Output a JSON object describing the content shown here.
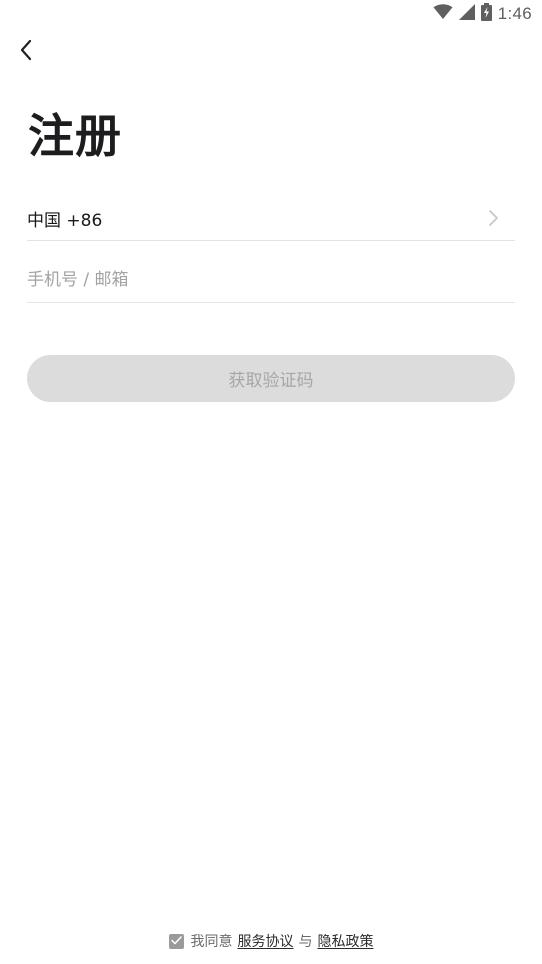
{
  "status_bar": {
    "time": "1:46",
    "icons": [
      "wifi-icon",
      "cellular-signal-icon",
      "battery-charging-icon"
    ]
  },
  "header": {
    "back_icon": "chevron-left-icon"
  },
  "page": {
    "title": "注册"
  },
  "form": {
    "country_label": "中国 +86",
    "country_chevron_icon": "chevron-right-icon",
    "phone_placeholder": "手机号 / 邮箱",
    "phone_value": "",
    "get_code_label": "获取验证码"
  },
  "agreement": {
    "checked": true,
    "prefix": "我同意",
    "service_link": "服务协议",
    "conjunction": "与",
    "privacy_link": "隐私政策"
  },
  "colors": {
    "button_disabled_bg": "#dcdcdc",
    "button_disabled_text": "#a6a6a6",
    "divider": "#e3e3e3",
    "placeholder": "#a3a3a3"
  }
}
